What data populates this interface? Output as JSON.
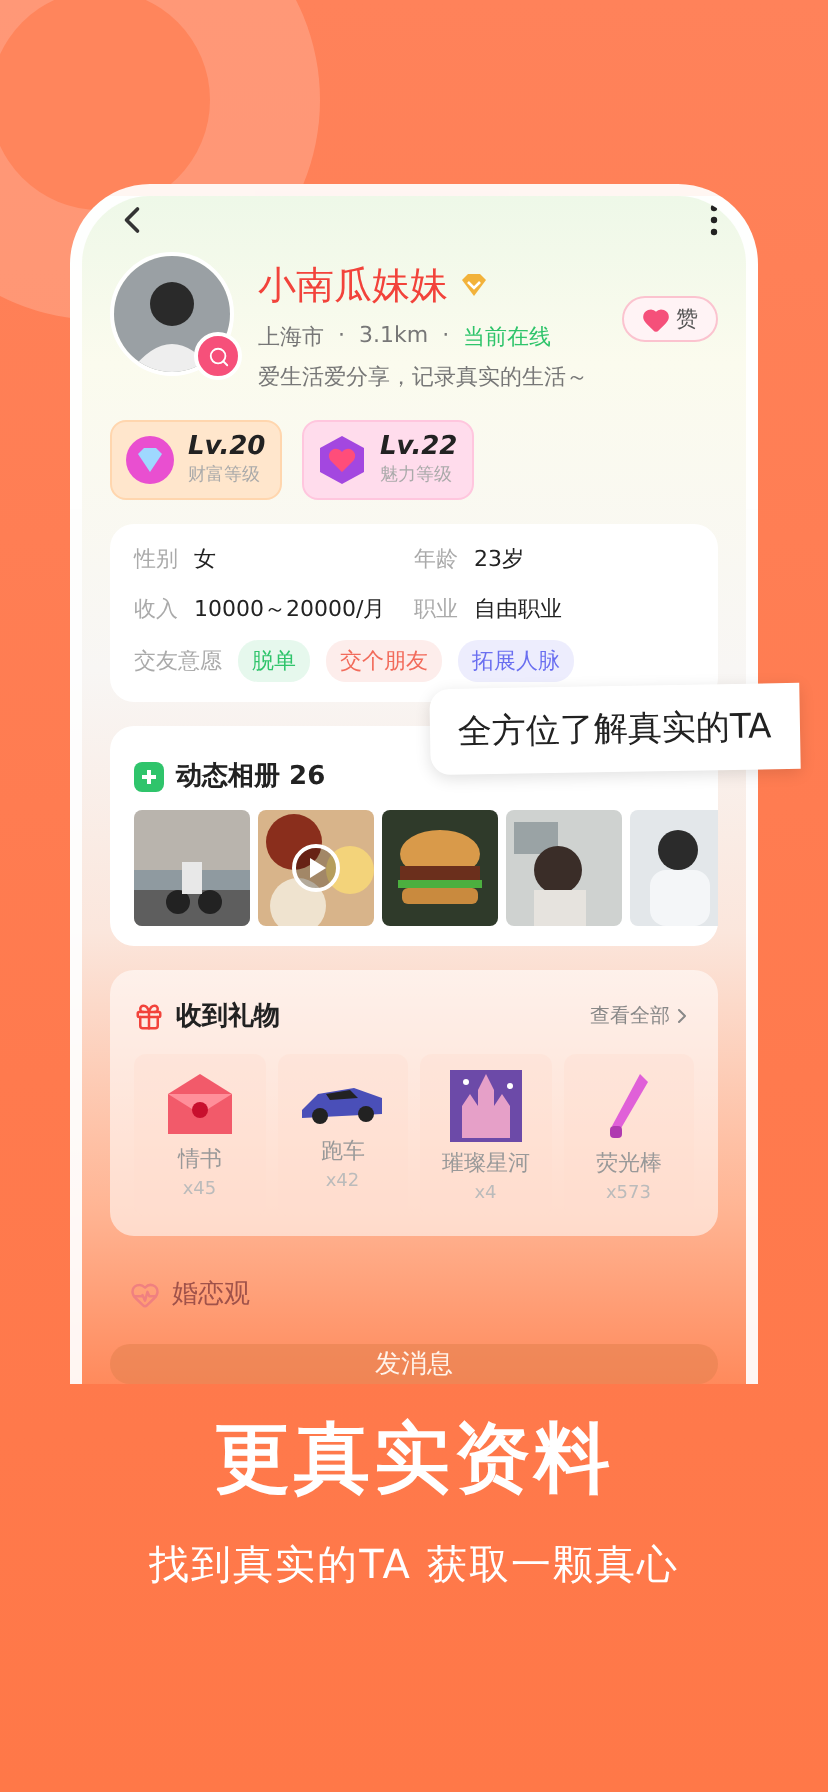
{
  "profile": {
    "name": "小南瓜妹妹",
    "verified": true,
    "meta": [
      {
        "text": "上海市",
        "kind": "plain"
      },
      {
        "text": "·",
        "kind": "dot"
      },
      {
        "text": "3.1km",
        "kind": "plain"
      },
      {
        "text": "·",
        "kind": "dot"
      },
      {
        "text": "当前在线",
        "kind": "online"
      }
    ],
    "bio": "爱生活爱分享，记录真实的生活～",
    "like": "赞"
  },
  "levels": [
    {
      "level": "Lv.20",
      "label": "财富等级",
      "kind": "wealth"
    },
    {
      "level": "Lv.22",
      "label": "魅力等级",
      "kind": "charm"
    }
  ],
  "info": [
    {
      "label": "性别",
      "value": "女"
    },
    {
      "label": "年龄",
      "value": "23岁"
    },
    {
      "label": "收入",
      "value": "10000～20000/月"
    },
    {
      "label": "职业",
      "value": "自由职业"
    }
  ],
  "intent": {
    "label": "交友意愿",
    "tags": [
      {
        "text": "脱单",
        "color": "#2fc46b"
      },
      {
        "text": "交个朋友",
        "color": "#f26b5b"
      },
      {
        "text": "拓展人脉",
        "color": "#6a6ff0"
      }
    ]
  },
  "album": {
    "title": "动态相册",
    "count": "26",
    "photos": [
      {
        "kind": "road",
        "video": false
      },
      {
        "kind": "food",
        "video": true
      },
      {
        "kind": "burger",
        "video": false
      },
      {
        "kind": "room",
        "video": false
      },
      {
        "kind": "person",
        "video": false
      }
    ]
  },
  "tooltip": "全方位了解真实的TA",
  "gifts": {
    "title": "收到礼物",
    "more": "查看全部",
    "items": [
      {
        "name": "情书",
        "count": "x45",
        "kind": "envelope"
      },
      {
        "name": "跑车",
        "count": "x42",
        "kind": "car"
      },
      {
        "name": "璀璨星河",
        "count": "x4",
        "kind": "castle"
      },
      {
        "name": "荧光棒",
        "count": "x573",
        "kind": "stick"
      }
    ]
  },
  "marriage": {
    "title": "婚恋观"
  },
  "message_button": "发消息",
  "headline": "更真实资料",
  "subtitle": "找到真实的TA 获取一颗真心"
}
